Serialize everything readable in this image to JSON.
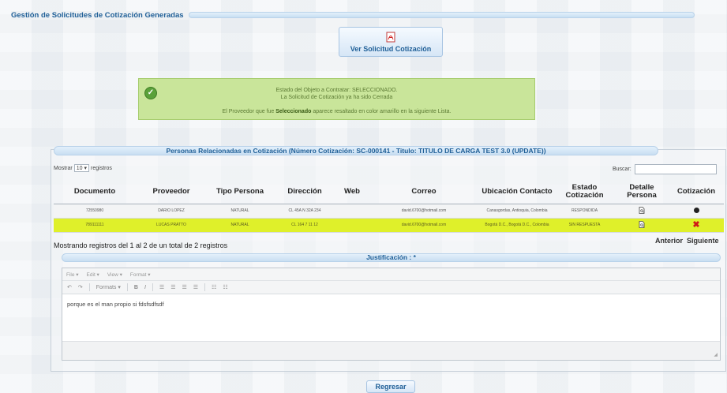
{
  "page": {
    "section_title": "Gestión de Solicitudes de Cotización Generadas"
  },
  "ver_solicitud": {
    "label": "Ver Solicitud Cotización",
    "icon": "pdf-icon"
  },
  "alert": {
    "line1": "Estado del Objeto a Contratar: SELECCIONADO.",
    "line2": "La Solicitud de Cotización ya ha sido Cerrada",
    "line3_pre": "El Proveedor que fue ",
    "line3_bold": "Seleccionado",
    "line3_post": " aparece resaltado en color amarillo en la siguiente Lista.",
    "color": "#c9e59a"
  },
  "panel": {
    "title": "Personas Relacionadas en Cotización (Número Cotización: SC-000141 - Titulo: TITULO DE CARGA TEST 3.0 (UPDATE))"
  },
  "table_controls": {
    "mostrar_label": "Mostrar",
    "page_size": "10",
    "registros_label": "registros",
    "buscar_label": "Buscar:"
  },
  "table": {
    "headers": [
      "Documento",
      "Proveedor",
      "Tipo Persona",
      "Dirección",
      "Web",
      "Correo",
      "Ubicación Contacto",
      "Estado Cotización",
      "Detalle Persona",
      "Cotización"
    ],
    "rows": [
      {
        "documento": "72550980",
        "proveedor": "DARIO LOPEZ",
        "tipo": "NATURAL",
        "direccion": "CL 45A N 32A 234",
        "web": "",
        "correo": "david.6700@hotmail.com",
        "ubicacion": "Canasgordas, Antioquia, Colombia",
        "estado": "RESPONDIDA",
        "highlight": false
      },
      {
        "documento": "789111111",
        "proveedor": "LUCAS PRATTO",
        "tipo": "NATURAL",
        "direccion": "CL 164 7 11 12",
        "web": "",
        "correo": "david.6700@hotmail.com",
        "ubicacion": "Bogotá D.C., Bogotá D.C., Colombia",
        "estado": "SIN RESPUESTA",
        "highlight": true
      }
    ],
    "highlight_color": "#dff02a"
  },
  "table_info": "Mostrando registros del 1 al 2 de un total de 2 registros",
  "pager": {
    "prev": "Anterior",
    "next": "Siguiente"
  },
  "justificacion": {
    "title": "Justificación : *",
    "menu": [
      "File ▾",
      "Edit ▾",
      "View ▾",
      "Format ▾"
    ],
    "formats_label": "Formats ▾",
    "content": "porque es el man propio si fdsfsdfsdf"
  },
  "regresar_label": "Regresar"
}
